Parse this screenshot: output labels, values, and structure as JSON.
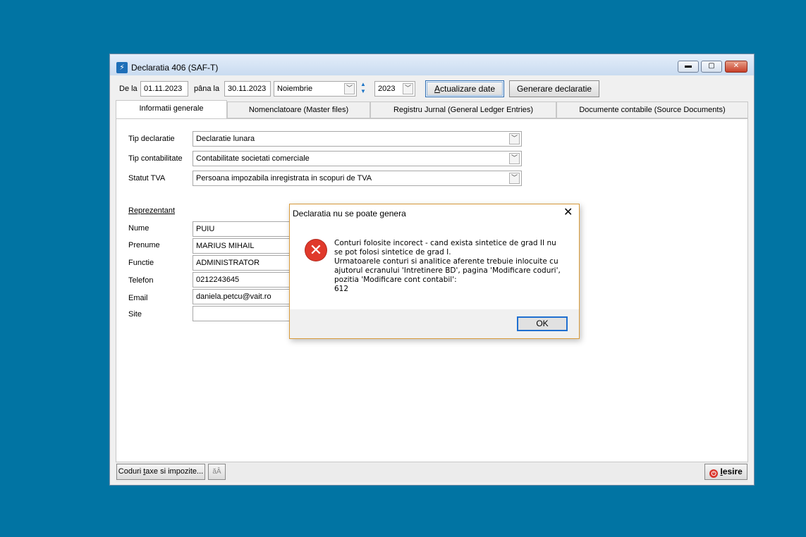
{
  "window": {
    "title": "Declaratia 406 (SAF-T)",
    "icon": "app-icon"
  },
  "toolbar": {
    "from_label": "De la",
    "from_date": "01.11.2023",
    "to_label": "pâna la",
    "to_date": "30.11.2023",
    "month": "Noiembrie",
    "year": "2023",
    "update_button_prefix": "A",
    "update_button_rest": "ctualizare date",
    "generate_button": "Generare declaratie"
  },
  "tabs": [
    {
      "label": "Informatii generale",
      "active": true
    },
    {
      "label": "Nomenclatoare (Master files)"
    },
    {
      "label": "Registru Jurnal (General Ledger Entries)"
    },
    {
      "label": "Documente contabile (Source Documents)"
    }
  ],
  "general": {
    "tip_declaratie_label": "Tip declaratie",
    "tip_declaratie_value": "Declaratie lunara",
    "tip_contabilitate_label": "Tip contabilitate",
    "tip_contabilitate_value": "Contabilitate societati comerciale",
    "statut_tva_label": "Statut TVA",
    "statut_tva_value": "Persoana impozabila inregistrata in scopuri de TVA"
  },
  "representative": {
    "heading": "Reprezentant",
    "fields": [
      {
        "label": "Nume",
        "value": "PUIU"
      },
      {
        "label": "Prenume",
        "value": "MARIUS MIHAIL"
      },
      {
        "label": "Functie",
        "value": "ADMINISTRATOR"
      },
      {
        "label": "Telefon",
        "value": "0212243645"
      },
      {
        "label": "Email",
        "value": "daniela.petcu@vait.ro"
      },
      {
        "label": "Site",
        "value": ""
      }
    ]
  },
  "statusbar": {
    "taxes_button_a": "Coduri ",
    "taxes_button_u": "t",
    "taxes_button_b": "axe si impozite...",
    "font_button": "ăÂ",
    "exit_button_u": "I",
    "exit_button_rest": "esire"
  },
  "dialog": {
    "title": "Declaratia nu se poate genera",
    "message_lines": [
      "Conturi folosite incorect - cand exista sintetice de grad II nu",
      "se pot folosi sintetice de grad I.",
      "Urmatoarele conturi si analitice aferente trebuie inlocuite cu",
      "ajutorul ecranului 'Intretinere BD', pagina 'Modificare coduri',",
      "pozitia 'Modificare cont contabil':",
      "612"
    ],
    "ok_label": "OK",
    "icon": "error-icon"
  },
  "colors": {
    "desktop": "#0174a3",
    "error": "#e0392b",
    "dialog_border": "#d89a3a"
  }
}
